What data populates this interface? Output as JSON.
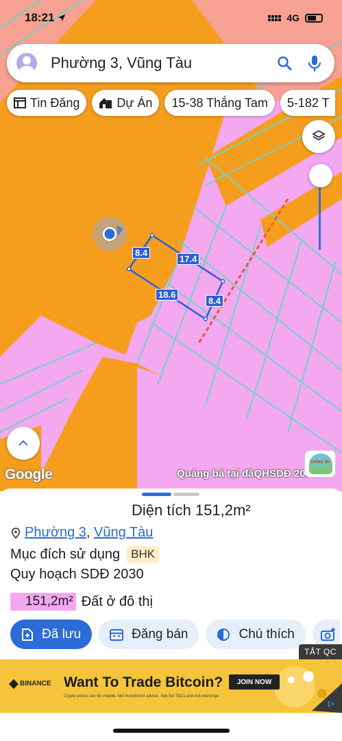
{
  "status_bar": {
    "time": "18:21",
    "network": "4G"
  },
  "search": {
    "query": "Phường 3, Vũng Tàu"
  },
  "chips": [
    {
      "label": "Tin Đăng",
      "icon": "newspaper-icon"
    },
    {
      "label": "Dự Án",
      "icon": "buildings-icon"
    },
    {
      "label": "15-38 Thắng Tam",
      "icon": ""
    },
    {
      "label": "5-182 T",
      "icon": ""
    }
  ],
  "map": {
    "dimensions": [
      "8.4",
      "17.4",
      "18.6",
      "8.4"
    ],
    "google_logo": "Google",
    "credit": "Quảng bá tại đâQHSDĐ 2030",
    "badge_text": "THÔNG TIN"
  },
  "sheet": {
    "area_title": "Diện tích 151,2m²",
    "address_parts": [
      "Phường 3",
      "Vũng Tàu"
    ],
    "address_separator": ",",
    "purpose_label": "Mục đích sử dụng",
    "purpose_code": "BHK",
    "plan_label": "Quy hoạch SDĐ 2030",
    "legend_area": "151,2m²",
    "legend_text": "Đất ở đô thị",
    "legend_color": "#f3a8f0"
  },
  "actions": [
    {
      "label": "Đã lưu",
      "icon": "bookmark-plus-icon",
      "primary": true
    },
    {
      "label": "Đăng bán",
      "icon": "calendar-icon",
      "primary": false
    },
    {
      "label": "Chú thích",
      "icon": "half-circle-icon",
      "primary": false
    }
  ],
  "ad": {
    "close_label": "TẮT QC",
    "brand": "BINANCE",
    "headline": "Want To Trade Bitcoin?",
    "cta": "JOIN NOW",
    "fine_print": "Crypto prices can be volatile. Not investment advice. See full T&Cs and risk warnings."
  },
  "colors": {
    "accent": "#2b6cd6",
    "map_orange": "#f59e1e",
    "map_pink": "#f3a8f0",
    "ad_yellow": "#f6c43a"
  }
}
